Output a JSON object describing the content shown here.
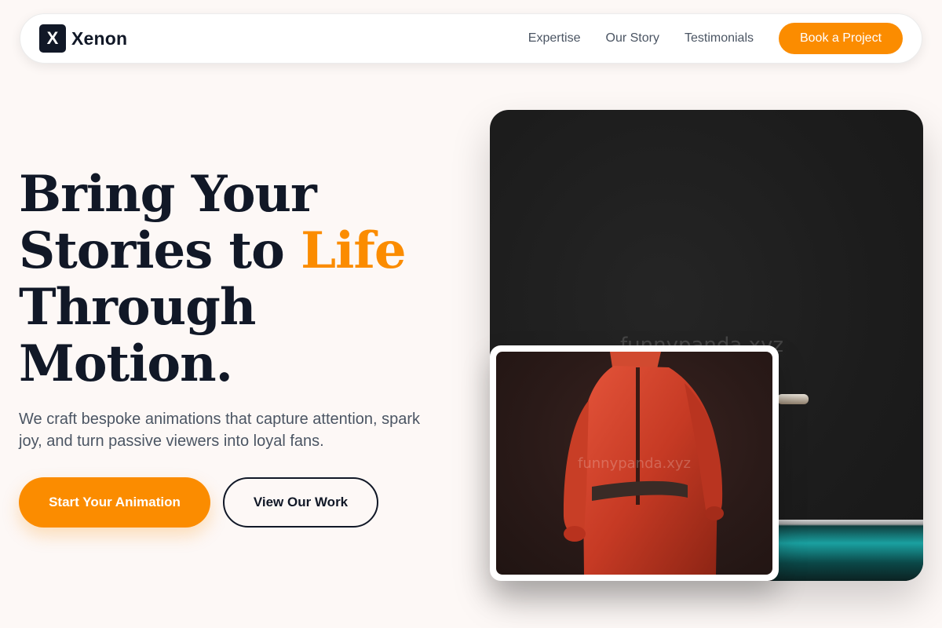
{
  "brand": {
    "logo_letter": "X",
    "name": "Xenon"
  },
  "nav": {
    "links": [
      "Expertise",
      "Our Story",
      "Testimonials"
    ],
    "cta": "Book a Project"
  },
  "hero": {
    "headline": {
      "line1": "Bring Your",
      "line2_prefix": "Stories to ",
      "line2_accent": "Life",
      "line3": "Through",
      "line4": "Motion."
    },
    "subtext": "We craft bespoke animations that capture attention, spark joy, and turn passive viewers into loyal fans.",
    "primary_button": "Start Your Animation",
    "secondary_button": "View Our Work"
  },
  "media": {
    "watermark_main": "funnypanda.xyz",
    "watermark_inset": "funnypanda.xyz"
  },
  "colors": {
    "accent": "#fb8c00",
    "dark": "#111827",
    "background": "#fdf8f6"
  }
}
